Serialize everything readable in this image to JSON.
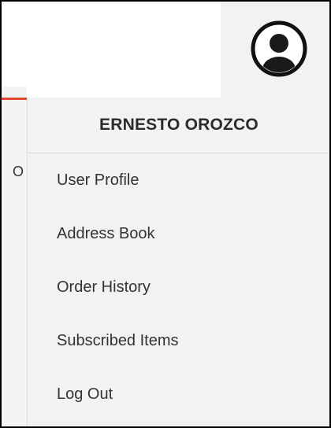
{
  "user_menu": {
    "user_name": "ERNESTO OROZCO",
    "items": [
      {
        "label": "User Profile"
      },
      {
        "label": "Address Book"
      },
      {
        "label": "Order History"
      },
      {
        "label": "Subscribed Items"
      },
      {
        "label": "Log Out"
      }
    ]
  },
  "background": {
    "peek_text": "Ol"
  },
  "colors": {
    "accent": "#e0492e",
    "menu_bg": "#f2f2f2",
    "text": "#333333"
  },
  "icons": {
    "avatar": "user-avatar-icon"
  }
}
